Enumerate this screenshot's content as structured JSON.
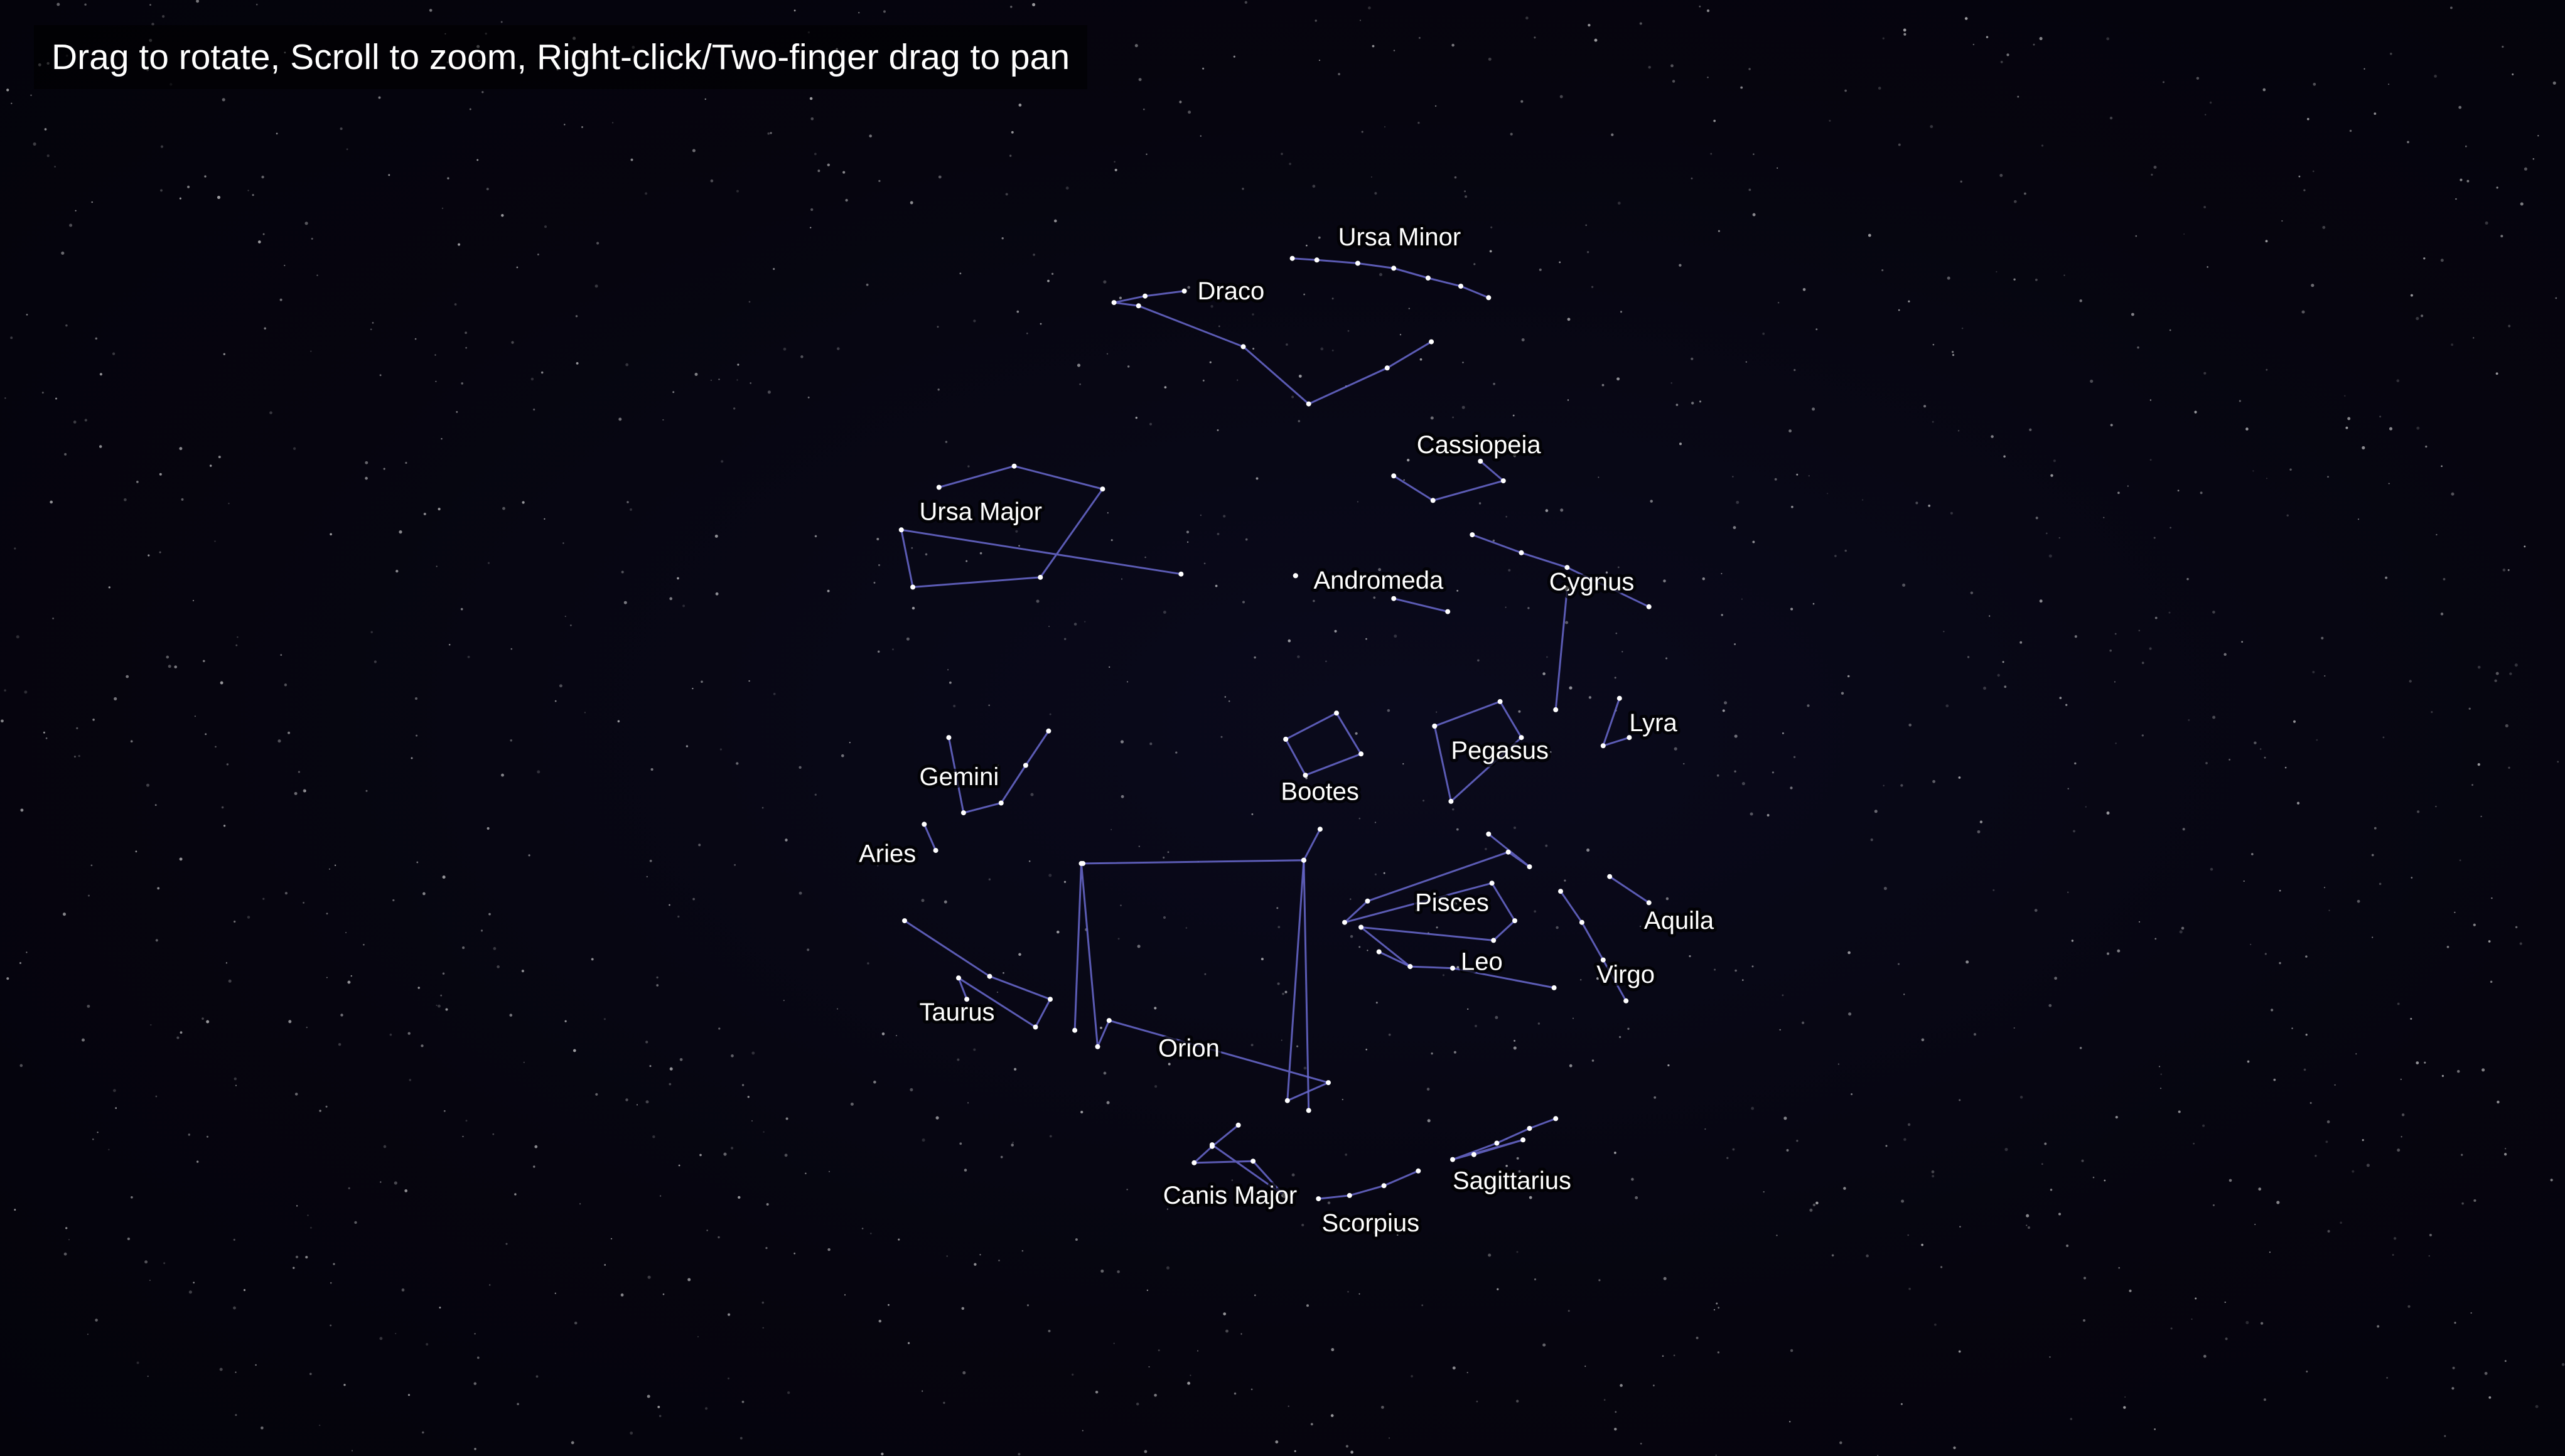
{
  "instructions": "Drag to rotate, Scroll to zoom, Right-click/Two-finger drag to pan",
  "colors": {
    "background": "#05040f",
    "line": "#6a6ad0",
    "star": "#ffffff",
    "label": "#ffffff"
  },
  "constellations": [
    {
      "name": "Ursa Minor"
    },
    {
      "name": "Draco"
    },
    {
      "name": "Cassiopeia"
    },
    {
      "name": "Ursa Major"
    },
    {
      "name": "Andromeda"
    },
    {
      "name": "Cygnus"
    },
    {
      "name": "Lyra"
    },
    {
      "name": "Pegasus"
    },
    {
      "name": "Gemini"
    },
    {
      "name": "Bootes"
    },
    {
      "name": "Aries"
    },
    {
      "name": "Pisces"
    },
    {
      "name": "Aquila"
    },
    {
      "name": "Leo"
    },
    {
      "name": "Virgo"
    },
    {
      "name": "Taurus"
    },
    {
      "name": "Orion"
    },
    {
      "name": "Canis Major"
    },
    {
      "name": "Sagittarius"
    },
    {
      "name": "Scorpius"
    }
  ]
}
